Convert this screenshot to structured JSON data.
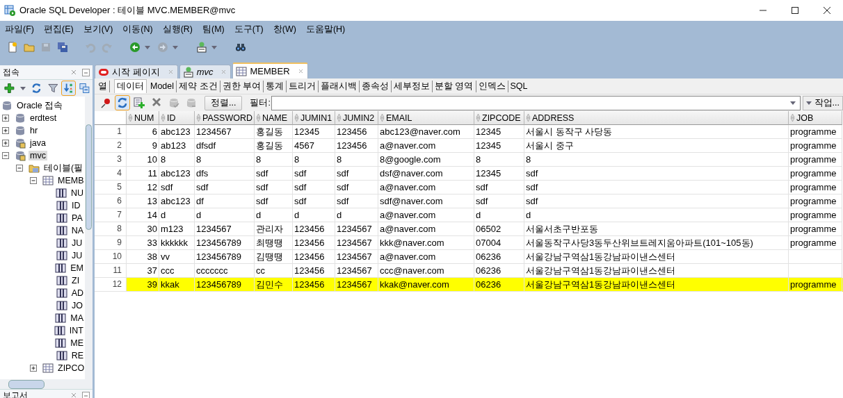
{
  "window": {
    "title": "Oracle SQL Developer : 테이블 MVC.MEMBER@mvc"
  },
  "menu": [
    "파일(F)",
    "편집(E)",
    "보기(V)",
    "이동(N)",
    "실행(R)",
    "팀(M)",
    "도구(T)",
    "창(W)",
    "도움말(H)"
  ],
  "toolbar": [
    {
      "kind": "new",
      "disabled": false
    },
    {
      "kind": "open",
      "disabled": false
    },
    {
      "kind": "save",
      "disabled": true
    },
    {
      "kind": "save-all",
      "disabled": false
    },
    {
      "kind": "undo",
      "disabled": true
    },
    {
      "kind": "redo",
      "disabled": true
    },
    {
      "kind": "back",
      "disabled": false
    },
    {
      "kind": "forward",
      "disabled": true
    },
    {
      "kind": "sql-worksheet",
      "disabled": false
    },
    {
      "kind": "find",
      "disabled": false
    }
  ],
  "navigator": {
    "title": "접속",
    "toolbar": [
      {
        "kind": "add",
        "pressed": false
      },
      {
        "kind": "refresh",
        "pressed": false
      },
      {
        "kind": "filter",
        "pressed": false
      },
      {
        "kind": "sort",
        "pressed": true
      },
      {
        "kind": "collapse",
        "pressed": false
      }
    ],
    "tree": [
      {
        "label": "Oracle 접속",
        "kind": "root",
        "selected": false,
        "children": [
          {
            "label": "erdtest",
            "kind": "db",
            "expanded": false,
            "selected": false
          },
          {
            "label": "hr",
            "kind": "db",
            "expanded": false,
            "selected": false
          },
          {
            "label": "java",
            "kind": "db-user",
            "expanded": false,
            "selected": false
          },
          {
            "label": "mvc",
            "kind": "db-user",
            "expanded": true,
            "selected": true,
            "children": [
              {
                "label": "테이블(필",
                "kind": "folder",
                "expanded": true,
                "selected": false,
                "children": [
                  {
                    "label": "MEMB",
                    "kind": "table",
                    "expanded": true,
                    "selected": false,
                    "children": [
                      {
                        "label": "NU",
                        "kind": "column",
                        "selected": false
                      },
                      {
                        "label": "ID",
                        "kind": "column",
                        "selected": false
                      },
                      {
                        "label": "PA",
                        "kind": "column",
                        "selected": false
                      },
                      {
                        "label": "NA",
                        "kind": "column",
                        "selected": false
                      },
                      {
                        "label": "JU",
                        "kind": "column",
                        "selected": false
                      },
                      {
                        "label": "JU",
                        "kind": "column",
                        "selected": false
                      },
                      {
                        "label": "EM",
                        "kind": "column",
                        "selected": false
                      },
                      {
                        "label": "ZI",
                        "kind": "column",
                        "selected": false
                      },
                      {
                        "label": "AD",
                        "kind": "column",
                        "selected": false
                      },
                      {
                        "label": "JO",
                        "kind": "column",
                        "selected": false
                      },
                      {
                        "label": "MA",
                        "kind": "column",
                        "selected": false
                      },
                      {
                        "label": "INT",
                        "kind": "column",
                        "selected": false
                      },
                      {
                        "label": "ME",
                        "kind": "column",
                        "selected": false
                      },
                      {
                        "label": "RE",
                        "kind": "column",
                        "selected": false
                      }
                    ]
                  },
                  {
                    "label": "ZIPCO",
                    "kind": "table",
                    "expanded": false,
                    "selected": false
                  }
                ]
              }
            ]
          }
        ]
      }
    ]
  },
  "next_panel": {
    "title": "보고서"
  },
  "editor": {
    "tabs": [
      {
        "label": "시작 페이지",
        "kind": "start",
        "selected": false
      },
      {
        "label": "mvc",
        "kind": "worksheet",
        "selected": false
      },
      {
        "label": "MEMBER",
        "kind": "table",
        "selected": true
      }
    ],
    "subtabs": [
      {
        "label": "열",
        "selected": false
      },
      {
        "label": "데이터",
        "selected": true
      },
      {
        "label": "Model",
        "selected": false
      },
      {
        "label": "제약 조건",
        "selected": false
      },
      {
        "label": "권한 부여",
        "selected": false
      },
      {
        "label": "통계",
        "selected": false
      },
      {
        "label": "트리거",
        "selected": false
      },
      {
        "label": "플래시백",
        "selected": false
      },
      {
        "label": "종속성",
        "selected": false
      },
      {
        "label": "세부정보",
        "selected": false
      },
      {
        "label": "분할 영역",
        "selected": false
      },
      {
        "label": "인덱스",
        "selected": false
      },
      {
        "label": "SQL",
        "selected": false
      }
    ],
    "data_toolbar": [
      {
        "kind": "pin",
        "pressed": false,
        "disabled": false
      },
      {
        "kind": "refresh",
        "pressed": true,
        "disabled": false
      },
      {
        "kind": "insert-row",
        "pressed": false,
        "disabled": false
      },
      {
        "kind": "delete-row",
        "pressed": false,
        "disabled": false
      },
      {
        "kind": "commit",
        "pressed": false,
        "disabled": true
      },
      {
        "kind": "rollback",
        "pressed": false,
        "disabled": true
      }
    ],
    "sort_button": "정렬...",
    "filter_label": "필터:",
    "actions_button": "작업...",
    "table": {
      "columns": [
        "NUM",
        "ID",
        "PASSWORD",
        "NAME",
        "JUMIN1",
        "JUMIN2",
        "EMAIL",
        "ZIPCODE",
        "ADDRESS",
        "JOB"
      ],
      "rows": [
        {
          "row_number": "1",
          "highlighted": false,
          "cells": [
            "6",
            "abc123",
            "1234567",
            "홍길동",
            "12345",
            "123456",
            "abc123@naver.com",
            "12345",
            "서울시 동작구 사당동",
            "programme"
          ]
        },
        {
          "row_number": "2",
          "highlighted": false,
          "cells": [
            "9",
            "ab123",
            "dfsdf",
            "홍길동",
            "4567",
            "123456",
            "a@naver.com",
            "12345",
            "서울시 중구",
            "programme"
          ]
        },
        {
          "row_number": "3",
          "highlighted": false,
          "cells": [
            "10",
            "8",
            "8",
            "8",
            "8",
            "8",
            "8@google.com",
            "8",
            "8",
            "programme"
          ]
        },
        {
          "row_number": "4",
          "highlighted": false,
          "cells": [
            "11",
            "abc123",
            "dfs",
            "sdf",
            "sdf",
            "sdf",
            "dsf@naver.com",
            "12345",
            "sdf",
            "programme"
          ]
        },
        {
          "row_number": "5",
          "highlighted": false,
          "cells": [
            "12",
            "sdf",
            "sdf",
            "sdf",
            "sdf",
            "sdf",
            "a@naver.com",
            "sdf",
            "sdf",
            "programme"
          ]
        },
        {
          "row_number": "6",
          "highlighted": false,
          "cells": [
            "13",
            "abc123",
            "df",
            "sdf",
            "sdf",
            "sdf",
            "sdf@naver.com",
            "sdf",
            "sdf",
            "programme"
          ]
        },
        {
          "row_number": "7",
          "highlighted": false,
          "cells": [
            "14",
            "d",
            "d",
            "d",
            "d",
            "d",
            "a@naver.com",
            "d",
            "d",
            "programme"
          ]
        },
        {
          "row_number": "8",
          "highlighted": false,
          "cells": [
            "30",
            "m123",
            "1234567",
            "관리자",
            "123456",
            "1234567",
            "a@naver.com",
            "06502",
            "서울서초구반포동",
            "programme"
          ]
        },
        {
          "row_number": "9",
          "highlighted": false,
          "cells": [
            "33",
            "kkkkkk",
            "123456789",
            "최땡땡",
            "123456",
            "1234567",
            "kkk@naver.com",
            "07004",
            "서울동작구사당3동두산위브트레지움아파트(101~105동)",
            "programme"
          ]
        },
        {
          "row_number": "10",
          "highlighted": false,
          "cells": [
            "38",
            "vv",
            "123456789",
            "김땡땡",
            "123456",
            "1234567",
            "a@naver.com",
            "06236",
            "서울강남구역삼1동강남파이낸스센터",
            null
          ]
        },
        {
          "row_number": "11",
          "highlighted": false,
          "cells": [
            "37",
            "ccc",
            "ccccccc",
            "cc",
            "123456",
            "1234567",
            "ccc@naver.com",
            "06236",
            "서울강남구역삼1동강남파이낸스센터",
            null
          ]
        },
        {
          "row_number": "12",
          "highlighted": true,
          "cells": [
            "39",
            "kkak",
            "123456789",
            "김민수",
            "123456",
            "1234567",
            "kkak@naver.com",
            "06236",
            "서울강남구역삼1동강남파이낸스센터",
            "programme"
          ]
        }
      ]
    }
  }
}
